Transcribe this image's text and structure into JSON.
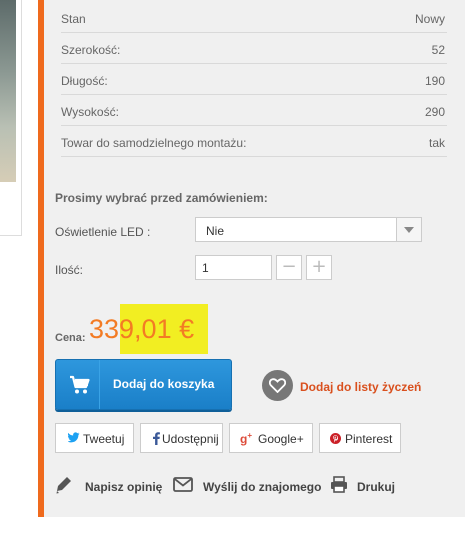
{
  "specs": [
    {
      "label": "Stan",
      "value": "Nowy"
    },
    {
      "label": "Szerokość:",
      "value": "52"
    },
    {
      "label": "Długość:",
      "value": "190"
    },
    {
      "label": "Wysokość:",
      "value": "290"
    },
    {
      "label": "Towar do samodzielnego montażu:",
      "value": "tak"
    }
  ],
  "options": {
    "title": "Prosimy wybrać przed zamówieniem:",
    "led_label": "Oświetlenie LED :",
    "led_value": "Nie",
    "qty_label": "Ilość:",
    "qty_value": "1",
    "minus": "−",
    "plus": "+"
  },
  "price": {
    "label": "Cena:",
    "value": "339,01 €"
  },
  "actions": {
    "cart_label": "Dodaj do koszyka",
    "wishlist_label": "Dodaj do listy życzeń"
  },
  "share": {
    "twitter": "Tweetuj",
    "facebook": "Udostępnij",
    "google": "Google+",
    "pinterest": "Pinterest"
  },
  "footer_links": {
    "review": "Napisz opinię",
    "send": "Wyślij do znajomego",
    "print": "Drukuj"
  },
  "colors": {
    "accent": "#ef6a1d",
    "price": "#f37b24",
    "cart_button": "#1a7fc8",
    "wishlist_text": "#d9501e",
    "highlight": "#f2ee22"
  },
  "icons": {
    "cart": "cart-icon",
    "wishlist": "heart-icon",
    "twitter": "twitter-icon",
    "facebook": "facebook-icon",
    "google": "google-plus-icon",
    "pinterest": "pinterest-icon",
    "review": "pencil-icon",
    "send": "envelope-icon",
    "print": "printer-icon"
  }
}
